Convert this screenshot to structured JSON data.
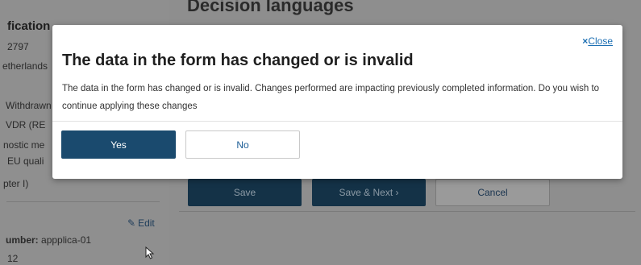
{
  "background": {
    "section_title": "Decision languages",
    "left_panel": {
      "heading": "fication",
      "lines": [
        "2797",
        "etherlands",
        "Withdrawn",
        "VDR (RE",
        "nostic me",
        "EU quali",
        "pter I)"
      ],
      "edit_label": "Edit",
      "number_label": "umber:",
      "number_value": "appplica-01",
      "footer_value": "12"
    },
    "buttons": {
      "save": "Save",
      "save_next": "Save & Next ›",
      "cancel": "Cancel"
    }
  },
  "modal": {
    "close_label": "Close",
    "close_icon": "×",
    "title": "The data in the form has changed or is invalid",
    "body": "The data in the form has changed or is invalid. Changes performed are impacting previously completed information. Do you wish to continue applying these changes",
    "yes_label": "Yes",
    "no_label": "No"
  },
  "colors": {
    "primary_button": "#1a4a6e",
    "link": "#1c6fb3",
    "overlay": "#8d8d8d"
  }
}
